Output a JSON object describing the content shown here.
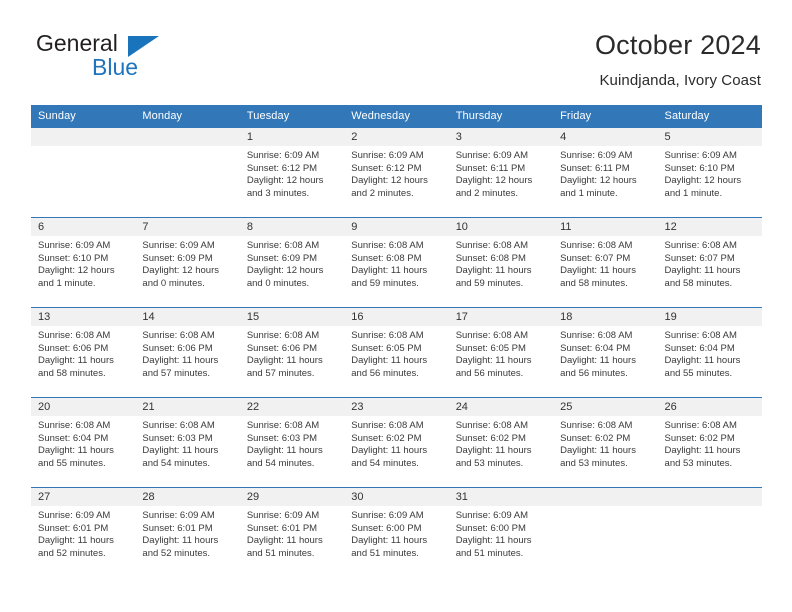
{
  "brand": {
    "name_part1": "General",
    "name_part2": "Blue",
    "logo_icon": "blue-triangle-logo"
  },
  "header": {
    "title": "October 2024",
    "subtitle": "Kuindjanda, Ivory Coast"
  },
  "colors": {
    "header_blue": "#3277b8",
    "brand_blue": "#1f74bd",
    "daynum_band": "#f1f1f1",
    "text": "#3a3a3a"
  },
  "calendar": {
    "weekday_headers": [
      "Sunday",
      "Monday",
      "Tuesday",
      "Wednesday",
      "Thursday",
      "Friday",
      "Saturday"
    ],
    "weeks": [
      [
        {
          "day": "",
          "empty": true
        },
        {
          "day": "",
          "empty": true
        },
        {
          "day": "1",
          "sunrise": "Sunrise: 6:09 AM",
          "sunset": "Sunset: 6:12 PM",
          "daylight_1": "Daylight: 12 hours",
          "daylight_2": "and 3 minutes."
        },
        {
          "day": "2",
          "sunrise": "Sunrise: 6:09 AM",
          "sunset": "Sunset: 6:12 PM",
          "daylight_1": "Daylight: 12 hours",
          "daylight_2": "and 2 minutes."
        },
        {
          "day": "3",
          "sunrise": "Sunrise: 6:09 AM",
          "sunset": "Sunset: 6:11 PM",
          "daylight_1": "Daylight: 12 hours",
          "daylight_2": "and 2 minutes."
        },
        {
          "day": "4",
          "sunrise": "Sunrise: 6:09 AM",
          "sunset": "Sunset: 6:11 PM",
          "daylight_1": "Daylight: 12 hours",
          "daylight_2": "and 1 minute."
        },
        {
          "day": "5",
          "sunrise": "Sunrise: 6:09 AM",
          "sunset": "Sunset: 6:10 PM",
          "daylight_1": "Daylight: 12 hours",
          "daylight_2": "and 1 minute."
        }
      ],
      [
        {
          "day": "6",
          "sunrise": "Sunrise: 6:09 AM",
          "sunset": "Sunset: 6:10 PM",
          "daylight_1": "Daylight: 12 hours",
          "daylight_2": "and 1 minute."
        },
        {
          "day": "7",
          "sunrise": "Sunrise: 6:09 AM",
          "sunset": "Sunset: 6:09 PM",
          "daylight_1": "Daylight: 12 hours",
          "daylight_2": "and 0 minutes."
        },
        {
          "day": "8",
          "sunrise": "Sunrise: 6:08 AM",
          "sunset": "Sunset: 6:09 PM",
          "daylight_1": "Daylight: 12 hours",
          "daylight_2": "and 0 minutes."
        },
        {
          "day": "9",
          "sunrise": "Sunrise: 6:08 AM",
          "sunset": "Sunset: 6:08 PM",
          "daylight_1": "Daylight: 11 hours",
          "daylight_2": "and 59 minutes."
        },
        {
          "day": "10",
          "sunrise": "Sunrise: 6:08 AM",
          "sunset": "Sunset: 6:08 PM",
          "daylight_1": "Daylight: 11 hours",
          "daylight_2": "and 59 minutes."
        },
        {
          "day": "11",
          "sunrise": "Sunrise: 6:08 AM",
          "sunset": "Sunset: 6:07 PM",
          "daylight_1": "Daylight: 11 hours",
          "daylight_2": "and 58 minutes."
        },
        {
          "day": "12",
          "sunrise": "Sunrise: 6:08 AM",
          "sunset": "Sunset: 6:07 PM",
          "daylight_1": "Daylight: 11 hours",
          "daylight_2": "and 58 minutes."
        }
      ],
      [
        {
          "day": "13",
          "sunrise": "Sunrise: 6:08 AM",
          "sunset": "Sunset: 6:06 PM",
          "daylight_1": "Daylight: 11 hours",
          "daylight_2": "and 58 minutes."
        },
        {
          "day": "14",
          "sunrise": "Sunrise: 6:08 AM",
          "sunset": "Sunset: 6:06 PM",
          "daylight_1": "Daylight: 11 hours",
          "daylight_2": "and 57 minutes."
        },
        {
          "day": "15",
          "sunrise": "Sunrise: 6:08 AM",
          "sunset": "Sunset: 6:06 PM",
          "daylight_1": "Daylight: 11 hours",
          "daylight_2": "and 57 minutes."
        },
        {
          "day": "16",
          "sunrise": "Sunrise: 6:08 AM",
          "sunset": "Sunset: 6:05 PM",
          "daylight_1": "Daylight: 11 hours",
          "daylight_2": "and 56 minutes."
        },
        {
          "day": "17",
          "sunrise": "Sunrise: 6:08 AM",
          "sunset": "Sunset: 6:05 PM",
          "daylight_1": "Daylight: 11 hours",
          "daylight_2": "and 56 minutes."
        },
        {
          "day": "18",
          "sunrise": "Sunrise: 6:08 AM",
          "sunset": "Sunset: 6:04 PM",
          "daylight_1": "Daylight: 11 hours",
          "daylight_2": "and 56 minutes."
        },
        {
          "day": "19",
          "sunrise": "Sunrise: 6:08 AM",
          "sunset": "Sunset: 6:04 PM",
          "daylight_1": "Daylight: 11 hours",
          "daylight_2": "and 55 minutes."
        }
      ],
      [
        {
          "day": "20",
          "sunrise": "Sunrise: 6:08 AM",
          "sunset": "Sunset: 6:04 PM",
          "daylight_1": "Daylight: 11 hours",
          "daylight_2": "and 55 minutes."
        },
        {
          "day": "21",
          "sunrise": "Sunrise: 6:08 AM",
          "sunset": "Sunset: 6:03 PM",
          "daylight_1": "Daylight: 11 hours",
          "daylight_2": "and 54 minutes."
        },
        {
          "day": "22",
          "sunrise": "Sunrise: 6:08 AM",
          "sunset": "Sunset: 6:03 PM",
          "daylight_1": "Daylight: 11 hours",
          "daylight_2": "and 54 minutes."
        },
        {
          "day": "23",
          "sunrise": "Sunrise: 6:08 AM",
          "sunset": "Sunset: 6:02 PM",
          "daylight_1": "Daylight: 11 hours",
          "daylight_2": "and 54 minutes."
        },
        {
          "day": "24",
          "sunrise": "Sunrise: 6:08 AM",
          "sunset": "Sunset: 6:02 PM",
          "daylight_1": "Daylight: 11 hours",
          "daylight_2": "and 53 minutes."
        },
        {
          "day": "25",
          "sunrise": "Sunrise: 6:08 AM",
          "sunset": "Sunset: 6:02 PM",
          "daylight_1": "Daylight: 11 hours",
          "daylight_2": "and 53 minutes."
        },
        {
          "day": "26",
          "sunrise": "Sunrise: 6:08 AM",
          "sunset": "Sunset: 6:02 PM",
          "daylight_1": "Daylight: 11 hours",
          "daylight_2": "and 53 minutes."
        }
      ],
      [
        {
          "day": "27",
          "sunrise": "Sunrise: 6:09 AM",
          "sunset": "Sunset: 6:01 PM",
          "daylight_1": "Daylight: 11 hours",
          "daylight_2": "and 52 minutes."
        },
        {
          "day": "28",
          "sunrise": "Sunrise: 6:09 AM",
          "sunset": "Sunset: 6:01 PM",
          "daylight_1": "Daylight: 11 hours",
          "daylight_2": "and 52 minutes."
        },
        {
          "day": "29",
          "sunrise": "Sunrise: 6:09 AM",
          "sunset": "Sunset: 6:01 PM",
          "daylight_1": "Daylight: 11 hours",
          "daylight_2": "and 51 minutes."
        },
        {
          "day": "30",
          "sunrise": "Sunrise: 6:09 AM",
          "sunset": "Sunset: 6:00 PM",
          "daylight_1": "Daylight: 11 hours",
          "daylight_2": "and 51 minutes."
        },
        {
          "day": "31",
          "sunrise": "Sunrise: 6:09 AM",
          "sunset": "Sunset: 6:00 PM",
          "daylight_1": "Daylight: 11 hours",
          "daylight_2": "and 51 minutes."
        },
        {
          "day": "",
          "empty": true
        },
        {
          "day": "",
          "empty": true
        }
      ]
    ]
  }
}
